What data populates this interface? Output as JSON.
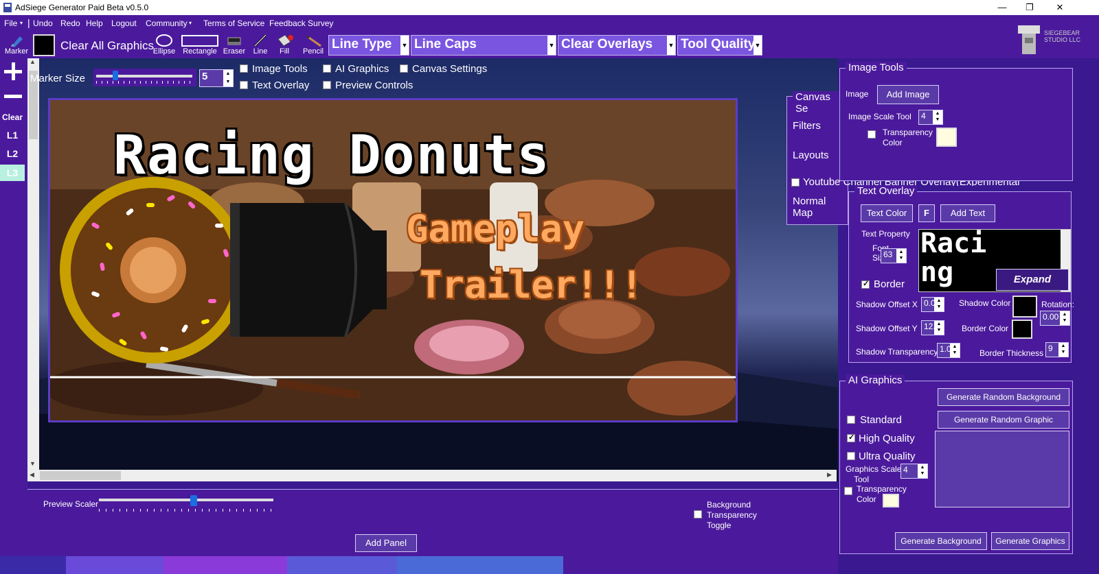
{
  "window": {
    "title": "AdSiege Generator Paid Beta v0.5.0",
    "minimize": "—",
    "maximize": "❐",
    "close": "✕"
  },
  "menu": {
    "file": "File",
    "undo": "Undo",
    "redo": "Redo",
    "help": "Help",
    "logout": "Logout",
    "community": "Community",
    "terms": "Terms of Service",
    "feedback": "Feedback Survey"
  },
  "toolbar": {
    "marker": "Marker",
    "clear_all": "Clear All Graphics",
    "ellipse": "Ellipse",
    "rectangle": "Rectangle",
    "eraser": "Eraser",
    "line": "Line",
    "fill": "Fill",
    "pencil": "Pencil",
    "line_type": "Line Type",
    "line_caps": "Line Caps",
    "clear_overlays": "Clear Overlays",
    "tool_quality": "Tool Quality",
    "logo_text": "SIEGEBEAR STUDIO LLC"
  },
  "leftbar": {
    "clear": "Clear",
    "l1": "L1",
    "l2": "L2",
    "l3": "L3"
  },
  "marker": {
    "label": "Marker Size",
    "value": "5"
  },
  "toggles": {
    "image_tools": "Image Tools",
    "ai_graphics": "AI Graphics",
    "canvas_settings": "Canvas Settings",
    "text_overlay": "Text Overlay",
    "preview_controls": "Preview Controls"
  },
  "banner": {
    "title": "Racing Donuts",
    "subtitle1": "Gameplay",
    "subtitle2": "Trailer!!!"
  },
  "canvas_settings": {
    "header": "Canvas Se",
    "filters": "Filters",
    "layouts": "Layouts",
    "youtube": "Youtube Channel Banner Overlay(Experimental)",
    "normal_map": "Normal Map"
  },
  "image_tools": {
    "header": "Image Tools",
    "image_label": "Image",
    "add_image": "Add Image",
    "scale_label": "Image Scale Tool",
    "scale_value": "4",
    "transparency_line1": "Transparency",
    "transparency_line2": "Color"
  },
  "text_overlay": {
    "header": "Text Overlay",
    "text_color": "Text Color",
    "font_btn": "F",
    "add_text": "Add Text",
    "text_property": "Text Property",
    "font_size_l1": "Font",
    "font_size_l2": "Size:",
    "font_size": "63",
    "preview_l1": "Raci",
    "preview_l2": "ng",
    "border": "Border",
    "expand": "Expand",
    "shadow_x_label": "Shadow Offset X",
    "shadow_x": "0.0",
    "shadow_color": "Shadow Color",
    "rotation": "Rotation:",
    "rotation_value": "0.00",
    "shadow_y_label": "Shadow Offset Y",
    "shadow_y": "12.5",
    "border_color": "Border Color",
    "shadow_transparency": "Shadow Transparency",
    "shadow_transparency_value": "1.00",
    "border_thickness": "Border Thickness",
    "border_thickness_value": "9"
  },
  "ai_graphics": {
    "header": "AI Graphics",
    "gen_random_bg": "Generate Random Background",
    "gen_random_graphic": "Generate Random Graphic",
    "standard": "Standard",
    "high_quality": "High Quality",
    "ultra_quality": "Ultra Quality",
    "scale_l1": "Graphics Scale",
    "scale_l2": "Tool",
    "scale_value": "4",
    "transparency_l1": "Transparency",
    "transparency_l2": "Color",
    "gen_bg": "Generate Background",
    "gen_graphics": "Generate Graphics"
  },
  "preview": {
    "scaler": "Preview Scaler",
    "bg_l1": "Background",
    "bg_l2": "Transparency",
    "bg_l3": "Toggle",
    "add_panel": "Add Panel"
  },
  "colors": {
    "panel": "#4b1a9c",
    "accent": "#7a55e0",
    "swatch_cream": "#fffce0"
  }
}
